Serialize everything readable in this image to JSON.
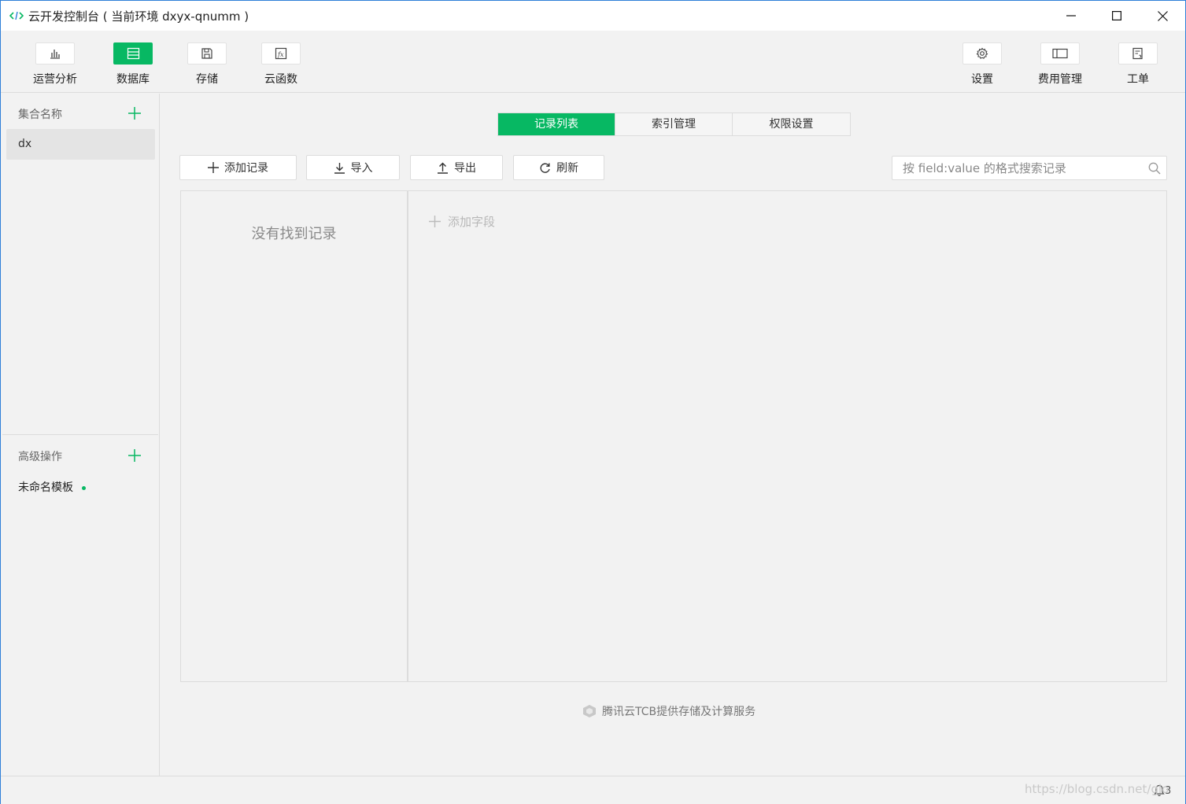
{
  "window": {
    "title": "云开发控制台 ( 当前环境 dxyx-qnumm )"
  },
  "toolbar": {
    "left_items": [
      {
        "label": "运营分析",
        "icon": "bar-chart-icon"
      },
      {
        "label": "数据库",
        "icon": "database-icon",
        "active": true
      },
      {
        "label": "存储",
        "icon": "storage-icon"
      },
      {
        "label": "云函数",
        "icon": "cloud-function-icon"
      }
    ],
    "right_items": [
      {
        "label": "设置",
        "icon": "gear-icon"
      },
      {
        "label": "费用管理",
        "icon": "billing-icon"
      },
      {
        "label": "工单",
        "icon": "ticket-icon"
      }
    ]
  },
  "sidebar": {
    "collections_header": "集合名称",
    "collections": [
      "dx"
    ],
    "advanced_header": "高级操作",
    "templates": [
      "未命名模板"
    ]
  },
  "tabs": [
    {
      "label": "记录列表",
      "active": true
    },
    {
      "label": "索引管理"
    },
    {
      "label": "权限设置"
    }
  ],
  "actions": {
    "add_record": "添加记录",
    "import": "导入",
    "export": "导出",
    "refresh": "刷新"
  },
  "search": {
    "placeholder": "按 field:value 的格式搜索记录"
  },
  "records": {
    "empty_text": "没有找到记录"
  },
  "fields": {
    "add_field": "添加字段"
  },
  "footer": {
    "provider_note": "腾讯云TCB提供存储及计算服务"
  },
  "status": {
    "notification_count": "3",
    "watermark": "https://blog.csdn.net/glo"
  },
  "colors": {
    "accent": "#07b863",
    "window_border": "#2e7fd8"
  }
}
